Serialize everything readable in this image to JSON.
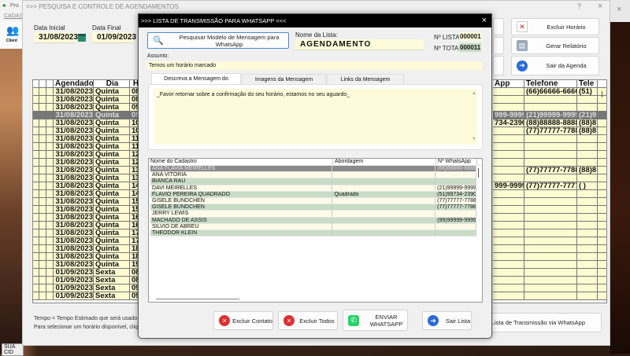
{
  "desktop": {
    "app_title": "Pro",
    "menu": "CADAS",
    "client_icon_label": "Client",
    "status": "SUA CID"
  },
  "main": {
    "title": ">>> PESQUISA E CONTROLE DE AGENDAMENTOS",
    "help": "?",
    "close": "×",
    "data_inicial_label": "Data Inicial",
    "data_inicial": "31/08/2023",
    "data_final_label": "Data Final",
    "data_final": "01/09/2023",
    "buttons": {
      "excluir_horario": "Excluir Horário",
      "gerar_relatorio": "Gerar Relatório",
      "sair_agenda": "Sair da Agenda",
      "enviar_lista": "Enviar Lista de Transmissão via WhatsApp"
    },
    "note1": "Tempo = Tempo Estimado que será usado no At",
    "note2": "Para selecionar um horário disponível, clique 2x",
    "grid": {
      "headers": [
        "",
        "",
        "",
        "Agendado",
        "Dia",
        "Ho"
      ],
      "right_headers": [
        "App",
        "Telefone",
        "Tele"
      ],
      "selected_row": 3,
      "rows": [
        [
          "31/08/2023",
          "Quinta",
          "08",
          "",
          "(66)66666-6666",
          "(51)"
        ],
        [
          "31/08/2023",
          "Quinta",
          "08",
          "",
          "",
          ""
        ],
        [
          "31/08/2023",
          "Quinta",
          "09",
          "",
          "",
          ""
        ],
        [
          "31/08/2023",
          "Quinta",
          "09",
          "999-9999",
          "(21)99999-9999",
          "(21)9"
        ],
        [
          "31/08/2023",
          "Quinta",
          "10",
          "734-2390",
          "(88)88888-8888",
          "(88)8"
        ],
        [
          "31/08/2023",
          "Quinta",
          "10",
          "",
          "(77)77777-7788",
          "(88)8"
        ],
        [
          "31/08/2023",
          "Quinta",
          "11",
          "",
          "",
          ""
        ],
        [
          "31/08/2023",
          "Quinta",
          "11",
          "",
          "",
          ""
        ],
        [
          "31/08/2023",
          "Quinta",
          "12",
          "",
          "",
          ""
        ],
        [
          "31/08/2023",
          "Quinta",
          "12",
          "",
          "",
          ""
        ],
        [
          "31/08/2023",
          "Quinta",
          "13",
          "",
          "(77)77777-7788",
          "(88)8"
        ],
        [
          "31/08/2023",
          "Quinta",
          "13",
          "",
          "",
          ""
        ],
        [
          "31/08/2023",
          "Quinta",
          "14",
          "999-9999",
          "(77)77777-7777",
          "( )"
        ],
        [
          "31/08/2023",
          "Quinta",
          "14",
          "",
          "",
          ""
        ],
        [
          "31/08/2023",
          "Quinta",
          "15",
          "",
          "",
          ""
        ],
        [
          "31/08/2023",
          "Quinta",
          "15",
          "",
          "",
          ""
        ],
        [
          "31/08/2023",
          "Quinta",
          "16",
          "",
          "",
          ""
        ],
        [
          "31/08/2023",
          "Quinta",
          "16",
          "",
          "",
          ""
        ],
        [
          "31/08/2023",
          "Quinta",
          "17",
          "",
          "",
          ""
        ],
        [
          "31/08/2023",
          "Quinta",
          "17",
          "",
          "",
          ""
        ],
        [
          "31/08/2023",
          "Quinta",
          "18",
          "",
          "",
          ""
        ],
        [
          "31/08/2023",
          "Quinta",
          "18",
          "",
          "",
          ""
        ],
        [
          "31/08/2023",
          "Quinta",
          "19",
          "",
          "",
          ""
        ],
        [
          "01/09/2023",
          "Sexta",
          "08",
          "",
          "",
          ""
        ],
        [
          "01/09/2023",
          "Sexta",
          "08",
          "",
          "",
          ""
        ],
        [
          "01/09/2023",
          "Sexta",
          "09",
          "",
          "",
          ""
        ],
        [
          "01/09/2023",
          "Sexta",
          "09",
          "",
          "",
          ""
        ]
      ]
    }
  },
  "dialog": {
    "title": ">>> LISTA DE TRANSMISSÃO PARA WHATSAPP <<<",
    "close": "×",
    "search_button": "Pesquisar Modelo de Mensagem para WhatsApp",
    "nome_lista_label": "Nome da Lista:",
    "nome_lista": "AGENDAMENTO",
    "n_lista_label": "Nº LISTA:",
    "n_lista": "000001",
    "n_total_label": "Nº TOTAL:",
    "n_total": "000011",
    "assunto_label": "Assunto:",
    "assunto": "Temos um horário marcado",
    "tabs": [
      "Descreva a Mensagem do WhatsApp",
      "Imagens da Mensagem WhatsApp",
      "Links da Mensagem WhatsApp"
    ],
    "message": "_Favor retornar sobre a confirmação do seu horário, estamos no seu aguardo_",
    "list": {
      "headers": [
        "Nome do Cadastro",
        "Abordagem",
        "Nº WhatsApp"
      ],
      "selected_row": 0,
      "rows": [
        [
          "ANA FLAVIA MEIRELLES",
          "",
          "(66)66666-6666"
        ],
        [
          "ANA VITÓRIA",
          "",
          ""
        ],
        [
          "BIANCA RAU",
          "",
          ""
        ],
        [
          "DAVI MEIRELLES",
          "",
          "(21)99999-9999"
        ],
        [
          "FLAVIO PEREIRA QUADRADO",
          "Quadrado",
          "(51)99734-2390"
        ],
        [
          "GISELE BUNDCHEN",
          "",
          "(77)77777-7788"
        ],
        [
          "GISELE BUNDCHEN",
          "",
          "(77)77777-7788"
        ],
        [
          "JERRY LEWIS",
          "",
          ""
        ],
        [
          "MACHADO DE ASSIS",
          "",
          "(99)99999-9999"
        ],
        [
          "SILVIO DE ABREU",
          "",
          ""
        ],
        [
          "THEODOR KLEIN",
          "",
          ""
        ]
      ]
    },
    "buttons": {
      "excluir_contato": "Excluir Contato",
      "excluir_todos": "Excluir Todos",
      "enviar": "ENVIAR WHATSAPP",
      "sair": "Sair Lista"
    }
  },
  "colors": {
    "field_yellow": "#fdfbd9",
    "row_green": "#c8dcc6",
    "whatsapp": "#25d366"
  }
}
